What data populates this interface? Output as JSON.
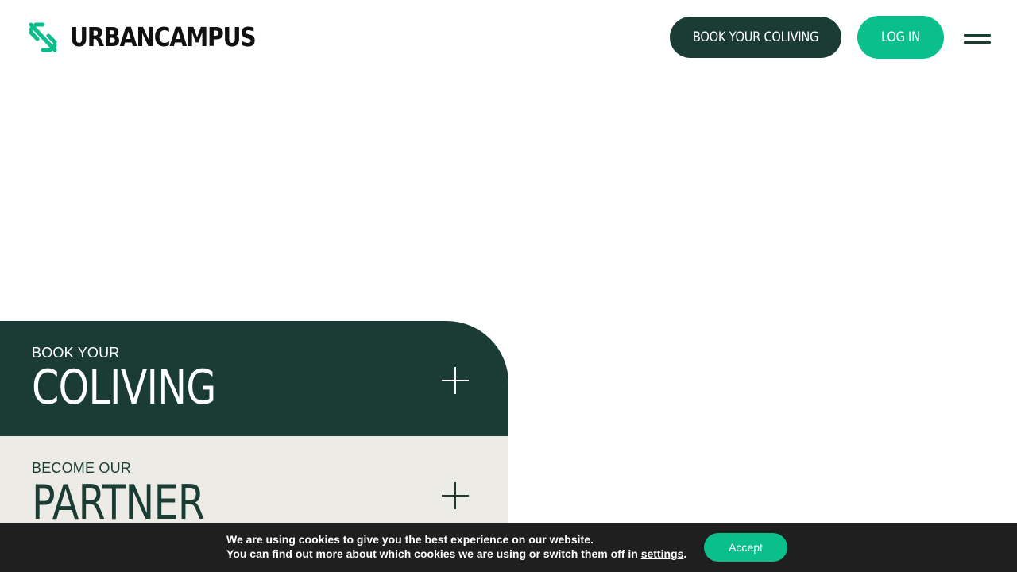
{
  "header": {
    "logo_text": "URBANCAMPUS",
    "logo_icon": "percent-logo-icon",
    "book_button_label": "BOOK YOUR COLIVING",
    "login_button_label": "LOG IN",
    "menu_icon": "hamburger-menu-icon"
  },
  "panels": [
    {
      "small_label": "BOOK YOUR",
      "big_label": "COLIVING",
      "icon": "plus-icon"
    },
    {
      "small_label": "BECOME OUR",
      "big_label": "PARTNER",
      "icon": "plus-icon"
    }
  ],
  "cookie_bar": {
    "line1": "We are using cookies to give you the best experience on our website.",
    "line2_prefix": "You can find out more about which cookies we are using or switch them off in ",
    "settings_link": "settings",
    "line2_suffix": ".",
    "accept_label": "Accept"
  },
  "colors": {
    "brand_dark_green": "#1a3c34",
    "brand_accent_green": "#0bbf8c",
    "panel_beige": "#edebe5",
    "cookie_bar_bg": "#1f1f1f"
  }
}
